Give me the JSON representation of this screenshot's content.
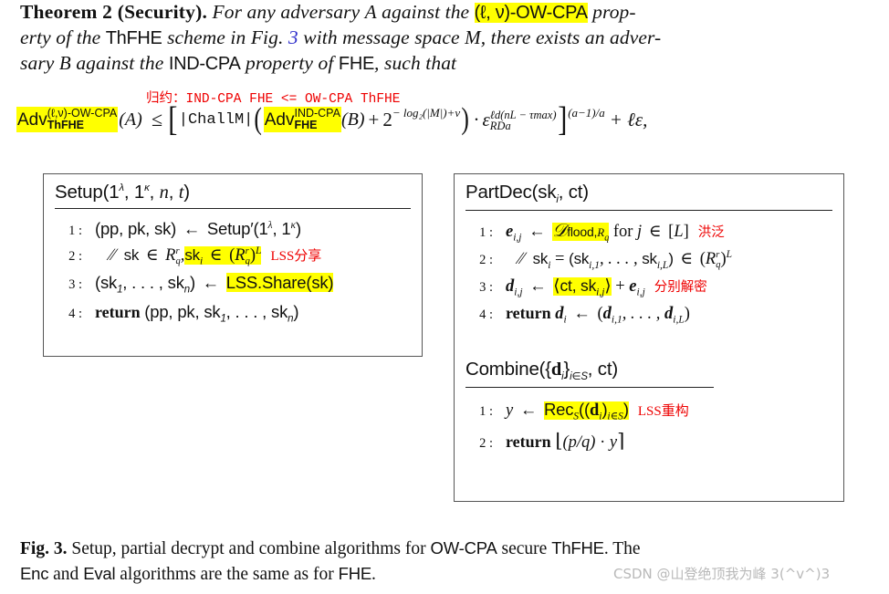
{
  "theorem": {
    "label": "Theorem 2",
    "name": "(Security).",
    "l1_a": "For any adversary ",
    "l1_adv_A": "A",
    "l1_b": " against the ",
    "l1_hl": "(ℓ, ν)-OW-CPA",
    "l1_c": " prop-",
    "l2_a": "erty of the ",
    "l2_thfhe": "ThFHE",
    "l2_b": " scheme in Fig. ",
    "l2_ref": "3",
    "l2_c": " with message space ",
    "l2_M": "M",
    "l2_d": ", there exists an adver-",
    "l3_a": "sary ",
    "l3_B": "B",
    "l3_b": " against the ",
    "l3_indcpa": "IND-CPA",
    "l3_c": " property of ",
    "l3_fhe": "FHE",
    "l3_d": ", such that"
  },
  "reduction_note": {
    "cjk": "归约：",
    "text": "IND-CPA FHE <= OW-CPA ThFHE"
  },
  "equation": {
    "lhs_adv": "Adv",
    "lhs_sup": "(ℓ,ν)-OW-CPA",
    "lhs_sub": "ThFHE",
    "lhs_arg": "(A)",
    "relation": "≤",
    "open_bracket": "[",
    "challm": "|ChallM|",
    "open_paren": "(",
    "rhs_adv": "Adv",
    "rhs_sup": "IND-CPA",
    "rhs_sub": "FHE",
    "rhs_arg": "(B)",
    "plus": "+",
    "two": "2",
    "two_exp": "− log₂(|M|)+ν",
    "close_paren": ")",
    "dot": "·",
    "eps": "ε",
    "eps_sup": "ℓd(nL − τmax)",
    "eps_sub": "RDa",
    "close_bracket": "]",
    "bracket_exp": "(a−1)/a",
    "tail": "+ ℓε,"
  },
  "setup_box": {
    "title": "Setup(1λ, 1κ, n, t)",
    "rows": [
      {
        "no": "1 :",
        "body": "(pp, pk, sk) ← Setup′(1λ, 1κ)",
        "annotation": ""
      },
      {
        "no": "2 :",
        "body": "∕∕  sk ∈ Rᵣq,  skᵢ ∈ (Rᵣq)ᴸ",
        "highlight": "skᵢ ∈ (Rᵣq)ᴸ",
        "annotation": "LSS分享"
      },
      {
        "no": "3 :",
        "body": "(sk₁, … , skₙ) ← LSS.Share(sk)",
        "highlight": "LSS.Share(sk)",
        "annotation": ""
      },
      {
        "no": "4 :",
        "body": "return (pp, pk, sk₁, … , skₙ)",
        "annotation": ""
      }
    ]
  },
  "partdec_box": {
    "title": "PartDec(skᵢ, ct)",
    "rows": [
      {
        "no": "1 :",
        "body": "eᵢ,ⱼ ← 𝒟flood,Rq  for j ∈ [L]",
        "highlight": "𝒟flood,Rq",
        "annotation": "洪泛"
      },
      {
        "no": "2 :",
        "body": "∕∕  skᵢ = (skᵢ,₁, … , skᵢ,L) ∈ (Rᵣq)ᴸ",
        "annotation": ""
      },
      {
        "no": "3 :",
        "body": "dᵢ,ⱼ ← ⟨ct, skᵢ,ⱼ⟩ + eᵢ,ⱼ",
        "highlight": "⟨ct, skᵢ,ⱼ⟩",
        "annotation": "分别解密"
      },
      {
        "no": "4 :",
        "body": "return dᵢ ← (dᵢ,₁, … , dᵢ,L)",
        "annotation": ""
      }
    ]
  },
  "combine_box": {
    "title": "Combine({dᵢ}ᵢ∈S, ct)",
    "rows": [
      {
        "no": "1 :",
        "body": "y ← Rec_S((dᵢ)ᵢ∈S)",
        "highlight": "Rec_S((dᵢ)ᵢ∈S)",
        "annotation": "LSS重构"
      },
      {
        "no": "2 :",
        "body": "return ⌊(p/q) · y⌉",
        "annotation": ""
      }
    ]
  },
  "caption": {
    "fig_label": "Fig. 3.",
    "l1_a": " Setup, partial decrypt and combine algorithms for ",
    "l1_owcpa": "OW-CPA",
    "l1_b": " secure ",
    "l1_thfhe": "ThFHE",
    "l1_c": ". The",
    "l2_enc": "Enc",
    "l2_a": " and ",
    "l2_eval": "Eval",
    "l2_b": " algorithms are the same as for ",
    "l2_fhe": "FHE",
    "l2_c": "."
  },
  "watermark": {
    "text": "CSDN @山登绝顶我为峰 3(^v^)3"
  },
  "colors": {
    "highlight": "#FFFF00",
    "annotation_red": "#EE0000",
    "hyperlink_blue": "#3333CC",
    "watermark_gray": "#B9B9B9",
    "box_border": "#555555"
  }
}
